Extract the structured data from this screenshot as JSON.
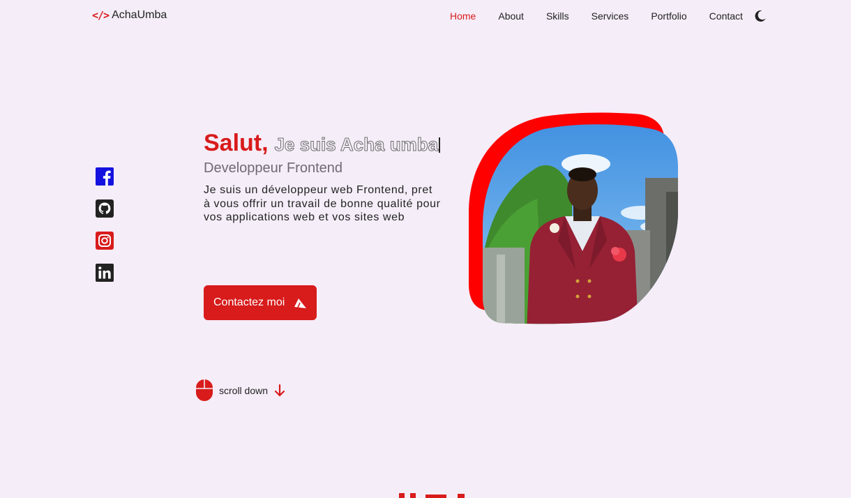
{
  "header": {
    "logo_symbol": "</>",
    "logo_text": "AchaUmba",
    "nav": [
      {
        "label": "Home",
        "active": true
      },
      {
        "label": "About",
        "active": false
      },
      {
        "label": "Skills",
        "active": false
      },
      {
        "label": "Services",
        "active": false
      },
      {
        "label": "Portfolio",
        "active": false
      },
      {
        "label": "Contact",
        "active": false
      }
    ],
    "theme_toggle_icon": "moon-icon"
  },
  "socials": [
    {
      "name": "facebook-icon",
      "color": "#1512e0"
    },
    {
      "name": "github-icon",
      "color": "#222222"
    },
    {
      "name": "instagram-icon",
      "color": "#d81b1b"
    },
    {
      "name": "linkedin-icon",
      "color": "#222222"
    }
  ],
  "hero": {
    "greeting": "Salut,",
    "intro": "Je suis Acha umba",
    "subtitle": "Developpeur Frontend",
    "description": "Je suis un développeur web Frontend, pret à vous offrir un travail de bonne qualité pour vos applications web et vos sites web",
    "button_label": "Contactez moi",
    "button_icon": "send-icon"
  },
  "scroll": {
    "label": "scroll down",
    "mouse_icon": "mouse-icon",
    "arrow_icon": "arrow-down-icon"
  },
  "colors": {
    "accent": "#d81b1b",
    "background": "#f5edf8",
    "blob": "#ff0000"
  }
}
